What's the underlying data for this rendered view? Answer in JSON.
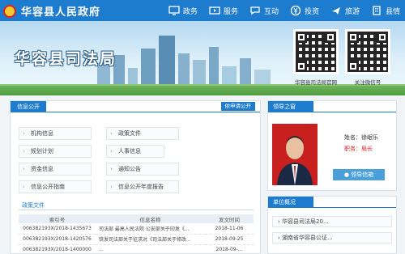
{
  "site": {
    "title": "华容县人民政府"
  },
  "nav": [
    {
      "label": "政务",
      "icon": "monitor-icon"
    },
    {
      "label": "服务",
      "icon": "video-icon"
    },
    {
      "label": "互动",
      "icon": "chat-icon"
    },
    {
      "label": "投资",
      "icon": "money-icon"
    },
    {
      "label": "旅游",
      "icon": "plane-icon"
    },
    {
      "label": "县情",
      "icon": "building-icon"
    }
  ],
  "banner": {
    "title": "华容县司法局",
    "qr1_label": "华容县司法局官网",
    "qr2_label": "关注微信号"
  },
  "info": {
    "heading": "信息公开",
    "apply_label": "依申请公开",
    "categories": [
      "机构信息",
      "政策文件",
      "规划计划",
      "人事信息",
      "资金信息",
      "通知公告",
      "信息公开指南",
      "信息公开年度报告"
    ]
  },
  "policy": {
    "heading": "政策文件",
    "columns": [
      "索引号",
      "信息名称",
      "发文时间"
    ],
    "rows": [
      [
        "006382193X/2018-1435673",
        "司法部 最高人民法院 公安部关于印发《...",
        "2018-11-06"
      ],
      [
        "006382193X/2018-1420576",
        "铁发司法部关于征求对《司法部关于修改...",
        "2018-09-25"
      ],
      [
        "006382193X/2018-1400000",
        "...",
        "2018-09-..."
      ]
    ]
  },
  "leader": {
    "heading": "领导之窗",
    "name": "姓名：徐岷乐",
    "job": "职务：局长",
    "mailbox_label": "领导信箱"
  },
  "org": {
    "heading": "单位概况",
    "items": [
      "华容县司法局20...",
      "湖南省华容县公证..."
    ]
  },
  "colors": {
    "primary": "#1e7ccf",
    "accent": "#d42222"
  }
}
